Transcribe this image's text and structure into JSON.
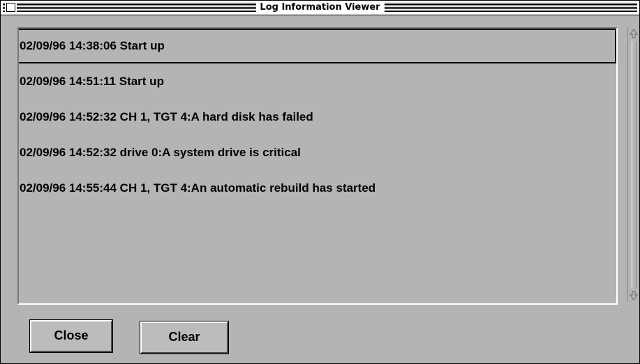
{
  "window": {
    "title": "Log Information Viewer"
  },
  "log": {
    "entries": [
      "02/09/96 14:38:06 Start up",
      "02/09/96 14:51:11 Start up",
      "02/09/96 14:52:32 CH 1, TGT 4:A hard disk has failed",
      "02/09/96 14:52:32 drive 0:A system drive is critical",
      "02/09/96 14:55:44 CH 1, TGT 4:An automatic rebuild has started"
    ],
    "selected_index": 0
  },
  "buttons": {
    "close_label": "Close",
    "clear_label": "Clear"
  },
  "icons": {
    "close_box": "close-box-icon",
    "scroll_up": "scroll-up-arrow-icon",
    "scroll_down": "scroll-down-arrow-icon"
  },
  "colors": {
    "window_background": "#b4b4b4",
    "text": "#000000"
  }
}
